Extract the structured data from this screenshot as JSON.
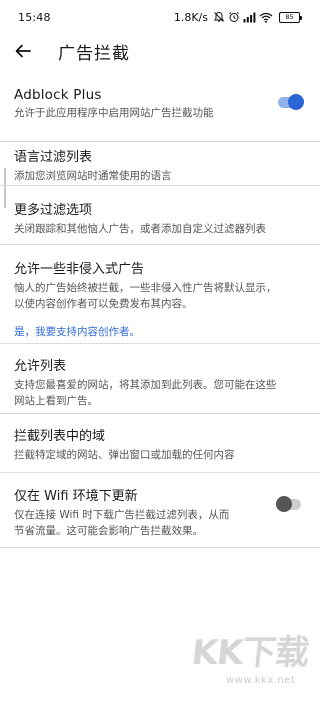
{
  "status_bar": {
    "time": "15:48",
    "net_speed": "1.8K/s",
    "battery": "85",
    "icons": [
      "mute-icon",
      "alarm-icon",
      "signal-icon",
      "wifi-icon",
      "battery-icon"
    ]
  },
  "header": {
    "back_icon": "back-arrow-icon",
    "title": "广告拦截"
  },
  "settings": {
    "adblock_plus": {
      "title": "Adblock Plus",
      "desc": "允许于此应用程序中启用网站广告拦截功能",
      "enabled": true
    },
    "language_filters": {
      "title": "语言过滤列表",
      "desc": "添加您浏览网站时通常使用的语言"
    },
    "more_filters": {
      "title": "更多过滤选项",
      "desc": "关闭跟踪和其他恼人广告，或者添加自定义过滤器列表"
    },
    "acceptable_ads": {
      "title": "允许一些非侵入式广告",
      "desc_line1": "恼人的广告始终被拦截，一些非侵入性广告将默认显示，",
      "desc_line2": "以使内容创作者可以免费发布其内容。",
      "link": "是，我要支持内容创作者。"
    },
    "allowlist": {
      "title": "允许列表",
      "desc_line1": "支持您最喜爱的网站，将其添加到此列表。您可能在这些",
      "desc_line2": "网站上看到广告。"
    },
    "blocked_domains": {
      "title": "拦截列表中的域",
      "desc": "拦截特定域的网站、弹出窗口或加载的任何内容"
    },
    "wifi_only": {
      "title": "仅在 Wifi 环境下更新",
      "desc_line1": "仅在连接 Wifi 时下载广告拦截过滤列表，从而",
      "desc_line2": "节省流量。这可能会影响广告拦截效果。",
      "enabled": false
    }
  },
  "watermark": {
    "text": "KK下载",
    "url": "www.kkx.net"
  },
  "colors": {
    "accent": "#2c66d6",
    "link": "#2f6ad8",
    "divider": "#dcdcdc"
  }
}
